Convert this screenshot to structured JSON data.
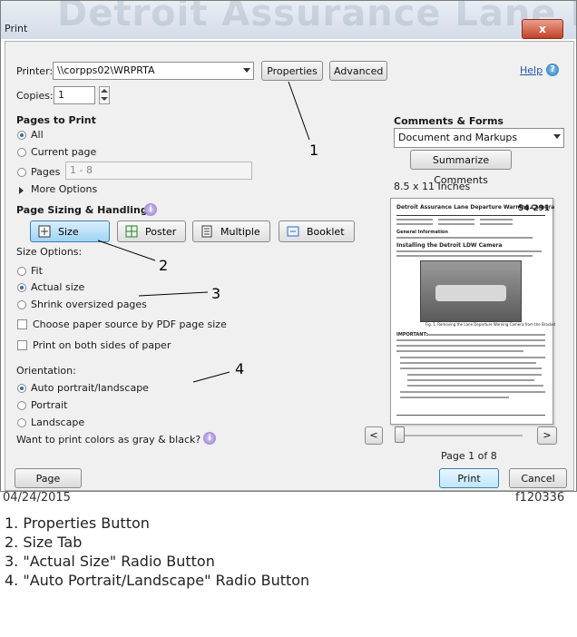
{
  "window": {
    "title": "Print",
    "background_heading": "Detroit Assurance Lane Departure Warning Camera",
    "close_glyph": "x"
  },
  "printer": {
    "label": "Printer:",
    "value": "\\\\corpps02\\WRPRTA",
    "properties_label": "Properties",
    "advanced_label": "Advanced",
    "help_label": "Help"
  },
  "copies": {
    "label": "Copies:",
    "value": "1"
  },
  "pages_to_print": {
    "heading": "Pages to Print",
    "all": "All",
    "current": "Current page",
    "pages": "Pages",
    "pages_value": "1 - 8",
    "more_options": "More Options"
  },
  "sizing": {
    "heading": "Page Sizing & Handling",
    "tabs": [
      "Size",
      "Poster",
      "Multiple",
      "Booklet"
    ],
    "size_options_label": "Size Options:",
    "options": [
      "Fit",
      "Actual size",
      "Shrink oversized pages"
    ],
    "selected_option": "Actual size",
    "choose_paper": "Choose paper source by PDF page size",
    "both_sides": "Print on both sides of paper"
  },
  "orientation": {
    "label": "Orientation:",
    "options": [
      "Auto portrait/landscape",
      "Portrait",
      "Landscape"
    ],
    "selected": "Auto portrait/landscape"
  },
  "gray_question": "Want to print colors as gray & black?",
  "comments": {
    "heading": "Comments & Forms",
    "value": "Document and Markups",
    "summarize": "Summarize Comments"
  },
  "preview": {
    "paper_size": "8.5 x 11 Inches",
    "doc_title": "Detroit Assurance Lane Departure Warning Camera",
    "doc_number": "54-291",
    "section_general": "General Information",
    "section_install": "Installing the Detroit LDW Camera",
    "photo_caption": "Fig. 1, Removing the Lane Departure Warning Camera from the Bracket",
    "important": "IMPORTANT:",
    "page_text": "Page 1 of 8",
    "prev": "<",
    "next": ">"
  },
  "buttons": {
    "page_setup": "Page Setup...",
    "print": "Print",
    "cancel": "Cancel"
  },
  "callouts": [
    "1",
    "2",
    "3",
    "4"
  ],
  "caption": {
    "date": "04/24/2015",
    "figure": "f120336",
    "legend": [
      "1.   Properties Button",
      "2.   Size Tab",
      "3.   \"Actual Size\" Radio Button",
      "4.   \"Auto Portrait/Landscape\" Radio Button"
    ]
  },
  "colors": {
    "accent": "#2c6fb3",
    "active_tab": "#9fd3f5",
    "close_button": "#c4402a"
  }
}
